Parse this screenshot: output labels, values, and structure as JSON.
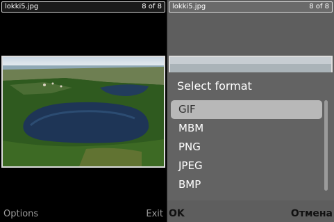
{
  "left_screen": {
    "title": {
      "filename": "lokki5.jpg",
      "count": "8 of 8"
    },
    "softkeys": {
      "left": "Options",
      "right": "Exit"
    }
  },
  "right_screen": {
    "title": {
      "filename": "lokki5.jpg",
      "count": "8 of 8"
    },
    "dialog": {
      "title": "Select format",
      "options": [
        "GIF",
        "MBM",
        "PNG",
        "JPEG",
        "BMP"
      ],
      "selected": "GIF"
    },
    "softkeys": {
      "left": "OK",
      "right": "Отмена"
    }
  },
  "colors": {
    "background_left": "#000000",
    "background_right": "#5e5e5e",
    "popup": "#636363",
    "highlight": "#b8b8b8"
  }
}
